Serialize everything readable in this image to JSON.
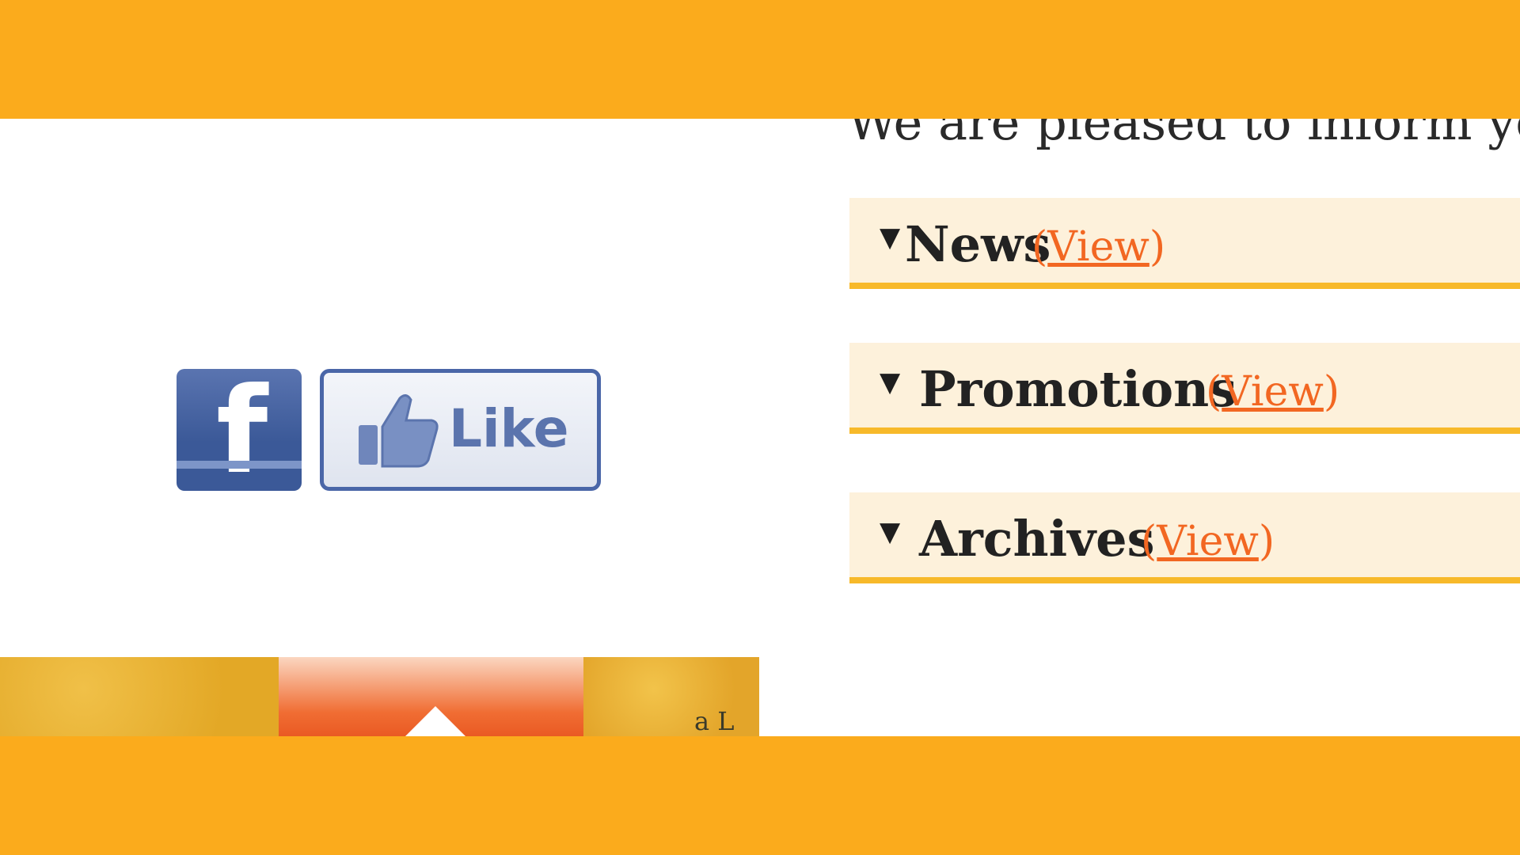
{
  "intro_text": "We are pleased to inform you",
  "sections": [
    {
      "arrow": "▼",
      "title": "News",
      "link_open": "(",
      "link_label": "View",
      "link_close": ")"
    },
    {
      "arrow": "▼",
      "title": "Promotions",
      "link_open": "(",
      "link_label": "View",
      "link_close": ")"
    },
    {
      "arrow": "▼",
      "title": "Archives",
      "link_open": "(",
      "link_label": "View",
      "link_close": ")"
    }
  ],
  "facebook": {
    "logo_letter": "f",
    "like_label": "Like",
    "brand_color": "#3b5998"
  },
  "footer_strip": {
    "icon": "up-arrow-icon",
    "fragment": "a L"
  },
  "colors": {
    "band": "#fbab1c",
    "section_bg": "#fdf1db",
    "section_border": "#f7b92a",
    "link": "#f26722"
  }
}
